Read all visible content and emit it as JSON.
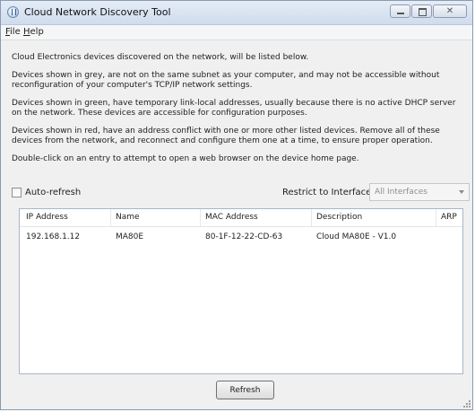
{
  "window": {
    "title": "Cloud Network Discovery Tool",
    "close_glyph": "✕"
  },
  "menu": {
    "file": {
      "mnemonic": "F",
      "rest": "ile"
    },
    "help": {
      "mnemonic": "H",
      "rest": "elp"
    }
  },
  "info": [
    "Cloud Electronics devices discovered on the network, will be listed below.",
    "Devices shown in grey, are not on the same subnet as your computer, and may not be accessible without reconfiguration of your computer's TCP/IP network settings.",
    "Devices shown in green, have temporary link-local addresses, usually because there is no active DHCP server on the network. These devices are accessible for configuration purposes.",
    "Devices shown in red, have an address conflict with one or more other listed devices. Remove all of these devices from the network, and reconnect and configure them one at a time, to ensure proper operation.",
    "Double-click on an entry to attempt to open a web browser on the device home page."
  ],
  "options": {
    "auto_refresh_label": "Auto-refresh",
    "auto_refresh_checked": false,
    "restrict_label": "Restrict to Interface:",
    "interface_selected": "All Interfaces"
  },
  "table": {
    "columns": [
      "IP Address",
      "Name",
      "MAC Address",
      "Description",
      "ARP"
    ],
    "rows": [
      [
        "192.168.1.12",
        "MA80E",
        "80-1F-12-22-CD-63",
        "Cloud MA80E - V1.0",
        ""
      ]
    ]
  },
  "buttons": {
    "refresh": "Refresh"
  },
  "icons": {
    "app": "app-globe-icon",
    "minimize": "minimize-icon",
    "maximize": "maximize-icon",
    "close": "close-icon",
    "dropdown": "chevron-down-icon",
    "resize": "resize-grip-icon"
  },
  "colors": {
    "titlebar_top": "#e4ecf6",
    "titlebar_bottom": "#cfdced",
    "window_bg": "#f0f0f0",
    "list_border": "#a9b6c6",
    "disabled_text": "#8e8e8e"
  }
}
